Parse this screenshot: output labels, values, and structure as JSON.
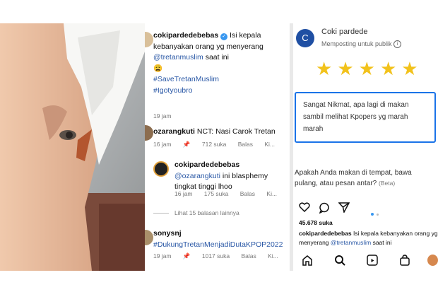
{
  "instagram": {
    "comments": [
      {
        "user": "cokipardedebebas",
        "text": "Isi kepala kebanyakan orang yg menyerang",
        "mention": "@tretanmuslim",
        "text2": "saat ini",
        "emoji": "😩",
        "tags": [
          "#SaveTretanMuslim",
          "#Igotyoubro"
        ],
        "time": "19 jam"
      },
      {
        "user": "ozarangkuti",
        "text": "NCT: Nasi Carok Tretan",
        "time": "16 jam",
        "likes": "712 suka",
        "reply": "Balas",
        "more": "Ki..."
      },
      {
        "user": "cokipardedebebas",
        "mention": "@ozarangkuti",
        "text": "ini blasphemy tingkat tinggi lhoo",
        "time": "16 jam",
        "likes": "175 suka",
        "reply": "Balas",
        "more": "Ki..."
      },
      {
        "view_replies": "Lihat 15 balasan lainnya"
      },
      {
        "user": "sonysnj",
        "tags": [
          "#DukungTretanMenjadiDutaKPOP2022"
        ],
        "time": "19 jam",
        "likes": "1017 suka",
        "reply": "Balas",
        "more": "Ki..."
      }
    ]
  },
  "review": {
    "avatar_letter": "C",
    "name": "Coki pardede",
    "subtitle": "Memposting untuk publik",
    "stars": [
      "★",
      "★",
      "★",
      "★",
      "★"
    ],
    "text": "Sangat Nikmat, apa lagi di makan sambil melihat Kpopers yg marah marah",
    "question": "Apakah Anda makan di tempat, bawa pulang, atau pesan antar?",
    "beta": "(Beta)",
    "ig_likes": "45.678 suka",
    "ig_caption_user": "cokipardedebebas",
    "ig_caption": "Isi kepala kebanyakan orang yg menyerang",
    "ig_caption_mention": "@tretanmuslim",
    "ig_caption_end": "saat ini"
  },
  "colors": {
    "star": "#f2c21b",
    "accent_blue": "#1a73e8",
    "link_blue": "#2a58a6",
    "avatar_blue": "#1f4fa3"
  }
}
